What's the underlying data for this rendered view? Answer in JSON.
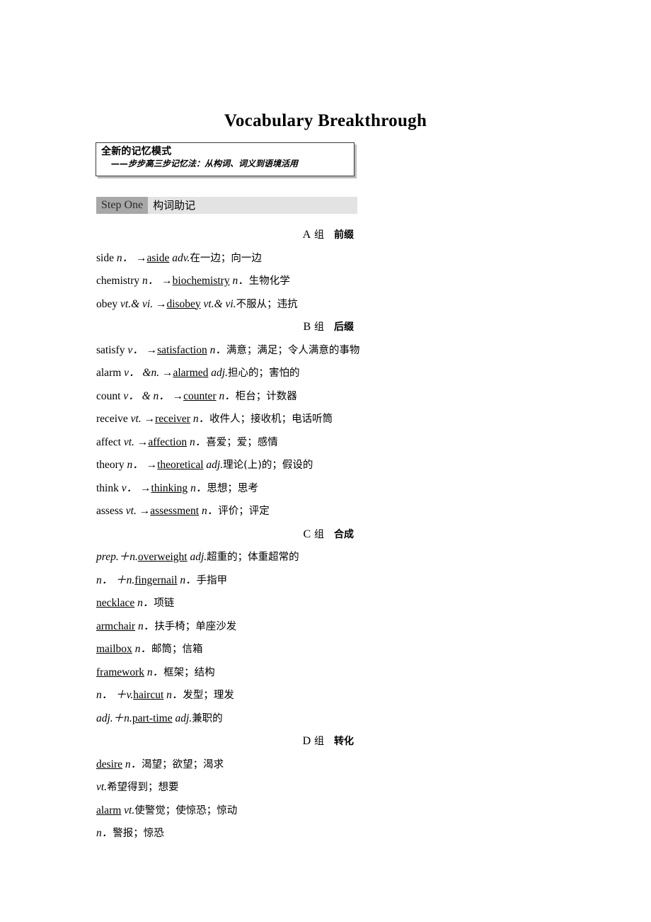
{
  "document": {
    "title": "Vocabulary Breakthrough",
    "callout": {
      "title": "全新的记忆模式",
      "subtitle": "——步步高三步记忆法：从构词、词义到语境活用"
    },
    "step": {
      "tag": "Step One",
      "name": "构词助记"
    },
    "groups": [
      {
        "letter": "A",
        "zu": "组",
        "kind": "前缀",
        "entries": [
          {
            "base": "side",
            "base_pos": "n．",
            "arrow": "→",
            "derived": "aside",
            "derived_pos": "adv.",
            "gloss": "在一边；向一边"
          },
          {
            "base": "chemistry",
            "base_pos": "n．",
            "arrow": "→",
            "derived": "biochemistry",
            "derived_pos": "n．",
            "gloss": "生物化学"
          },
          {
            "base": "obey",
            "base_pos": "vt.& vi.",
            "arrow": "→",
            "derived": "disobey",
            "derived_pos": "vt.& vi.",
            "gloss": "不服从；违抗"
          }
        ]
      },
      {
        "letter": "B",
        "zu": "组",
        "kind": "后缀",
        "entries": [
          {
            "base": "satisfy",
            "base_pos": "v．",
            "arrow": "→",
            "derived": "satisfaction",
            "derived_pos": "n．",
            "gloss": "满意；满足；令人满意的事物"
          },
          {
            "base": "alarm",
            "base_pos": "v． &n.",
            "arrow": "→",
            "derived": "alarmed",
            "derived_pos": "adj.",
            "gloss": "担心的；害怕的"
          },
          {
            "base": "count",
            "base_pos": "v． & n．",
            "arrow": "→",
            "derived": "counter",
            "derived_pos": "n．",
            "gloss": "柜台；计数器"
          },
          {
            "base": "receive",
            "base_pos": "vt.",
            "arrow": "→",
            "derived": "receiver",
            "derived_pos": "n．",
            "gloss": "收件人；接收机；电话听筒"
          },
          {
            "base": "affect",
            "base_pos": "vt.",
            "arrow": "→",
            "derived": "affection",
            "derived_pos": "n．",
            "gloss": "喜爱；爱；感情"
          },
          {
            "base": "theory",
            "base_pos": "n．",
            "arrow": "→",
            "derived": "theoretical",
            "derived_pos": "adj.",
            "gloss": "理论(上)的；假设的"
          },
          {
            "base": "think",
            "base_pos": "v．",
            "arrow": "→",
            "derived": "thinking",
            "derived_pos": "n．",
            "gloss": "思想；思考"
          },
          {
            "base": "assess",
            "base_pos": "vt.",
            "arrow": "→",
            "derived": "assessment",
            "derived_pos": "n．",
            "gloss": "评价；评定"
          }
        ]
      },
      {
        "letter": "C",
        "zu": "组",
        "kind": "合成",
        "entries": [
          {
            "formula": "prep.＋n.",
            "derived": "overweight",
            "derived_pos": "adj.",
            "gloss": "超重的；体重超常的"
          },
          {
            "formula": "n． ＋n.",
            "derived": "fingernail",
            "derived_pos": "n．",
            "gloss": "手指甲"
          },
          {
            "formula": "",
            "derived": "necklace",
            "derived_pos": "n．",
            "gloss": "项链"
          },
          {
            "formula": "",
            "derived": "armchair",
            "derived_pos": "n．",
            "gloss": "扶手椅；单座沙发"
          },
          {
            "formula": "",
            "derived": "mailbox",
            "derived_pos": "n．",
            "gloss": "邮筒；信箱"
          },
          {
            "formula": "",
            "derived": "framework",
            "derived_pos": "n．",
            "gloss": "框架；结构"
          },
          {
            "formula": "n． ＋v.",
            "derived": "haircut",
            "derived_pos": "n．",
            "gloss": "发型；理发"
          },
          {
            "formula": "adj.＋n.",
            "derived": "part-time",
            "derived_pos": "adj.",
            "gloss": "兼职的"
          }
        ]
      },
      {
        "letter": "D",
        "zu": "组",
        "kind": "转化",
        "entries": [
          {
            "headword": "desire",
            "pos": "n．",
            "gloss": "渴望；欲望；渴求"
          },
          {
            "headword": "",
            "pos": "vt.",
            "gloss": "希望得到；想要"
          },
          {
            "headword": "alarm",
            "pos": "vt.",
            "gloss": "使警觉；使惊恐；惊动"
          },
          {
            "headword": "",
            "pos": "n．",
            "gloss": "警报；惊恐"
          }
        ]
      }
    ]
  }
}
